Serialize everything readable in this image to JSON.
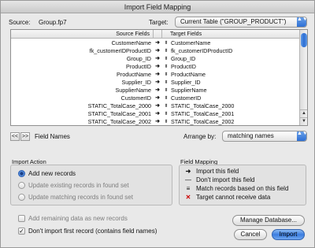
{
  "window": {
    "title": "Import Field Mapping"
  },
  "source": {
    "label": "Source:",
    "value": "Group.fp7"
  },
  "target": {
    "label": "Target:",
    "selected": "Current Table (\"GROUP_PRODUCT\")"
  },
  "table": {
    "headers": {
      "source": "Source Fields",
      "target": "Target Fields"
    },
    "rows": [
      {
        "source": "CustomerName",
        "arrow": "➜",
        "target": "CustomerName"
      },
      {
        "source": "fk_customerIDProductID",
        "arrow": "➜",
        "target": "fk_customerIDProductID"
      },
      {
        "source": "Group_ID",
        "arrow": "➜",
        "target": "Group_ID"
      },
      {
        "source": "ProductID",
        "arrow": "➜",
        "target": "ProductID"
      },
      {
        "source": "ProductName",
        "arrow": "➜",
        "target": "ProductName"
      },
      {
        "source": "Supplier_ID",
        "arrow": "➜",
        "target": "Supplier_ID"
      },
      {
        "source": "SupplierName",
        "arrow": "➜",
        "target": "SupplierName"
      },
      {
        "source": "CustomerID",
        "arrow": "➜",
        "target": "CustomerID"
      },
      {
        "source": "STATIC_TotalCase_2000",
        "arrow": "➜",
        "target": "STATIC_TotalCase_2000"
      },
      {
        "source": "STATIC_TotalCase_2001",
        "arrow": "➜",
        "target": "STATIC_TotalCase_2001"
      },
      {
        "source": "STATIC_TotalCase_2002",
        "arrow": "➜",
        "target": "STATIC_TotalCase_2002"
      },
      {
        "source": "STATIC_TotalCase_2003",
        "arrow": "➜",
        "target": "STATIC_TotalCase_2003"
      }
    ]
  },
  "navigation": {
    "prev": "<<",
    "next": ">>",
    "label": "Field Names"
  },
  "arrange": {
    "label": "Arrange by:",
    "selected": "matching names"
  },
  "import_action": {
    "title": "Import Action",
    "options": [
      {
        "label": "Add new records",
        "selected": true
      },
      {
        "label": "Update existing records in found set",
        "selected": false
      },
      {
        "label": "Update matching records in found set",
        "selected": false
      }
    ]
  },
  "field_mapping_legend": {
    "title": "Field Mapping",
    "items": [
      {
        "symbol": "➜",
        "label": "Import this field"
      },
      {
        "symbol": "—",
        "label": "Don't import this field"
      },
      {
        "symbol": "≡",
        "label": "Match records based on this field"
      },
      {
        "symbol": "✕",
        "label": "Target cannot receive data"
      }
    ]
  },
  "options": {
    "add_remaining": {
      "label": "Add remaining data as new records",
      "checked": false
    },
    "dont_import_first": {
      "label": "Don't import first record (contains field names)",
      "checked": true,
      "mark": "✓"
    }
  },
  "buttons": {
    "manage_db": "Manage Database...",
    "cancel": "Cancel",
    "import": "Import"
  },
  "scrollbar": {
    "up": "▲",
    "down": "▼"
  },
  "select_arrow": "▲▼",
  "colors": {
    "accent": "#2d6fd4",
    "default_button": "#3b7de0",
    "error_red": "#cc0000"
  }
}
